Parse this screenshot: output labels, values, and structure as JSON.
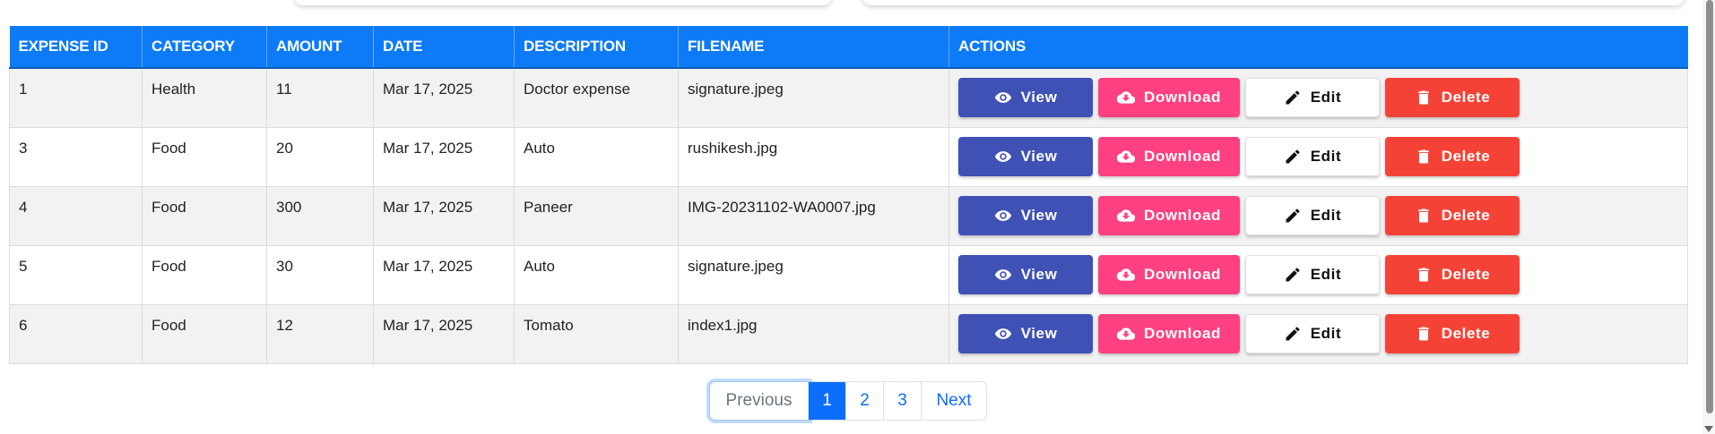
{
  "table": {
    "headers": [
      "EXPENSE ID",
      "CATEGORY",
      "AMOUNT",
      "DATE",
      "DESCRIPTION",
      "FILENAME",
      "ACTIONS"
    ],
    "rows": [
      {
        "id": "1",
        "category": "Health",
        "amount": "11",
        "date": "Mar 17, 2025",
        "description": "Doctor expense",
        "filename": "signature.jpeg"
      },
      {
        "id": "3",
        "category": "Food",
        "amount": "20",
        "date": "Mar 17, 2025",
        "description": "Auto",
        "filename": "rushikesh.jpg"
      },
      {
        "id": "4",
        "category": "Food",
        "amount": "300",
        "date": "Mar 17, 2025",
        "description": "Paneer",
        "filename": "IMG-20231102-WA0007.jpg"
      },
      {
        "id": "5",
        "category": "Food",
        "amount": "30",
        "date": "Mar 17, 2025",
        "description": "Auto",
        "filename": "signature.jpeg"
      },
      {
        "id": "6",
        "category": "Food",
        "amount": "12",
        "date": "Mar 17, 2025",
        "description": "Tomato",
        "filename": "index1.jpg"
      }
    ],
    "header_color": "#0d7bf7"
  },
  "actions": {
    "view": {
      "label": "View",
      "icon": "eye-icon",
      "color": "#3f51b5"
    },
    "download": {
      "label": "Download",
      "icon": "cloud-download-icon",
      "color": "#ff4081"
    },
    "edit": {
      "label": "Edit",
      "icon": "pencil-icon",
      "color": "#ffffff"
    },
    "delete": {
      "label": "Delete",
      "icon": "trash-icon",
      "color": "#f44336"
    }
  },
  "pagination": {
    "previous": "Previous",
    "pages": [
      "1",
      "2",
      "3"
    ],
    "active_page": "1",
    "next": "Next"
  }
}
